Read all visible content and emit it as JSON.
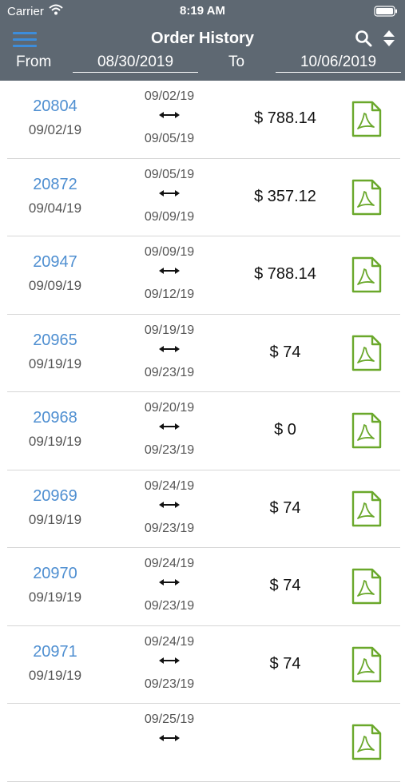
{
  "status_bar": {
    "carrier": "Carrier",
    "time": "8:19 AM"
  },
  "header": {
    "title": "Order History",
    "from_label": "From",
    "from_date": "08/30/2019",
    "to_label": "To",
    "to_date": "10/06/2019"
  },
  "colors": {
    "header_bg": "#5e6872",
    "accent_blue": "#3d8ddb",
    "link_blue": "#4f8fd1",
    "pdf_green": "#6aa82b"
  },
  "orders": [
    {
      "id": "20804",
      "date": "09/02/19",
      "start": "09/02/19",
      "end": "09/05/19",
      "amount": "$ 788.14"
    },
    {
      "id": "20872",
      "date": "09/04/19",
      "start": "09/05/19",
      "end": "09/09/19",
      "amount": "$ 357.12"
    },
    {
      "id": "20947",
      "date": "09/09/19",
      "start": "09/09/19",
      "end": "09/12/19",
      "amount": "$ 788.14"
    },
    {
      "id": "20965",
      "date": "09/19/19",
      "start": "09/19/19",
      "end": "09/23/19",
      "amount": "$ 74"
    },
    {
      "id": "20968",
      "date": "09/19/19",
      "start": "09/20/19",
      "end": "09/23/19",
      "amount": "$ 0"
    },
    {
      "id": "20969",
      "date": "09/19/19",
      "start": "09/24/19",
      "end": "09/23/19",
      "amount": "$ 74"
    },
    {
      "id": "20970",
      "date": "09/19/19",
      "start": "09/24/19",
      "end": "09/23/19",
      "amount": "$ 74"
    },
    {
      "id": "20971",
      "date": "09/19/19",
      "start": "09/24/19",
      "end": "09/23/19",
      "amount": "$ 74"
    },
    {
      "id": "",
      "date": "",
      "start": "09/25/19",
      "end": "",
      "amount": ""
    }
  ]
}
